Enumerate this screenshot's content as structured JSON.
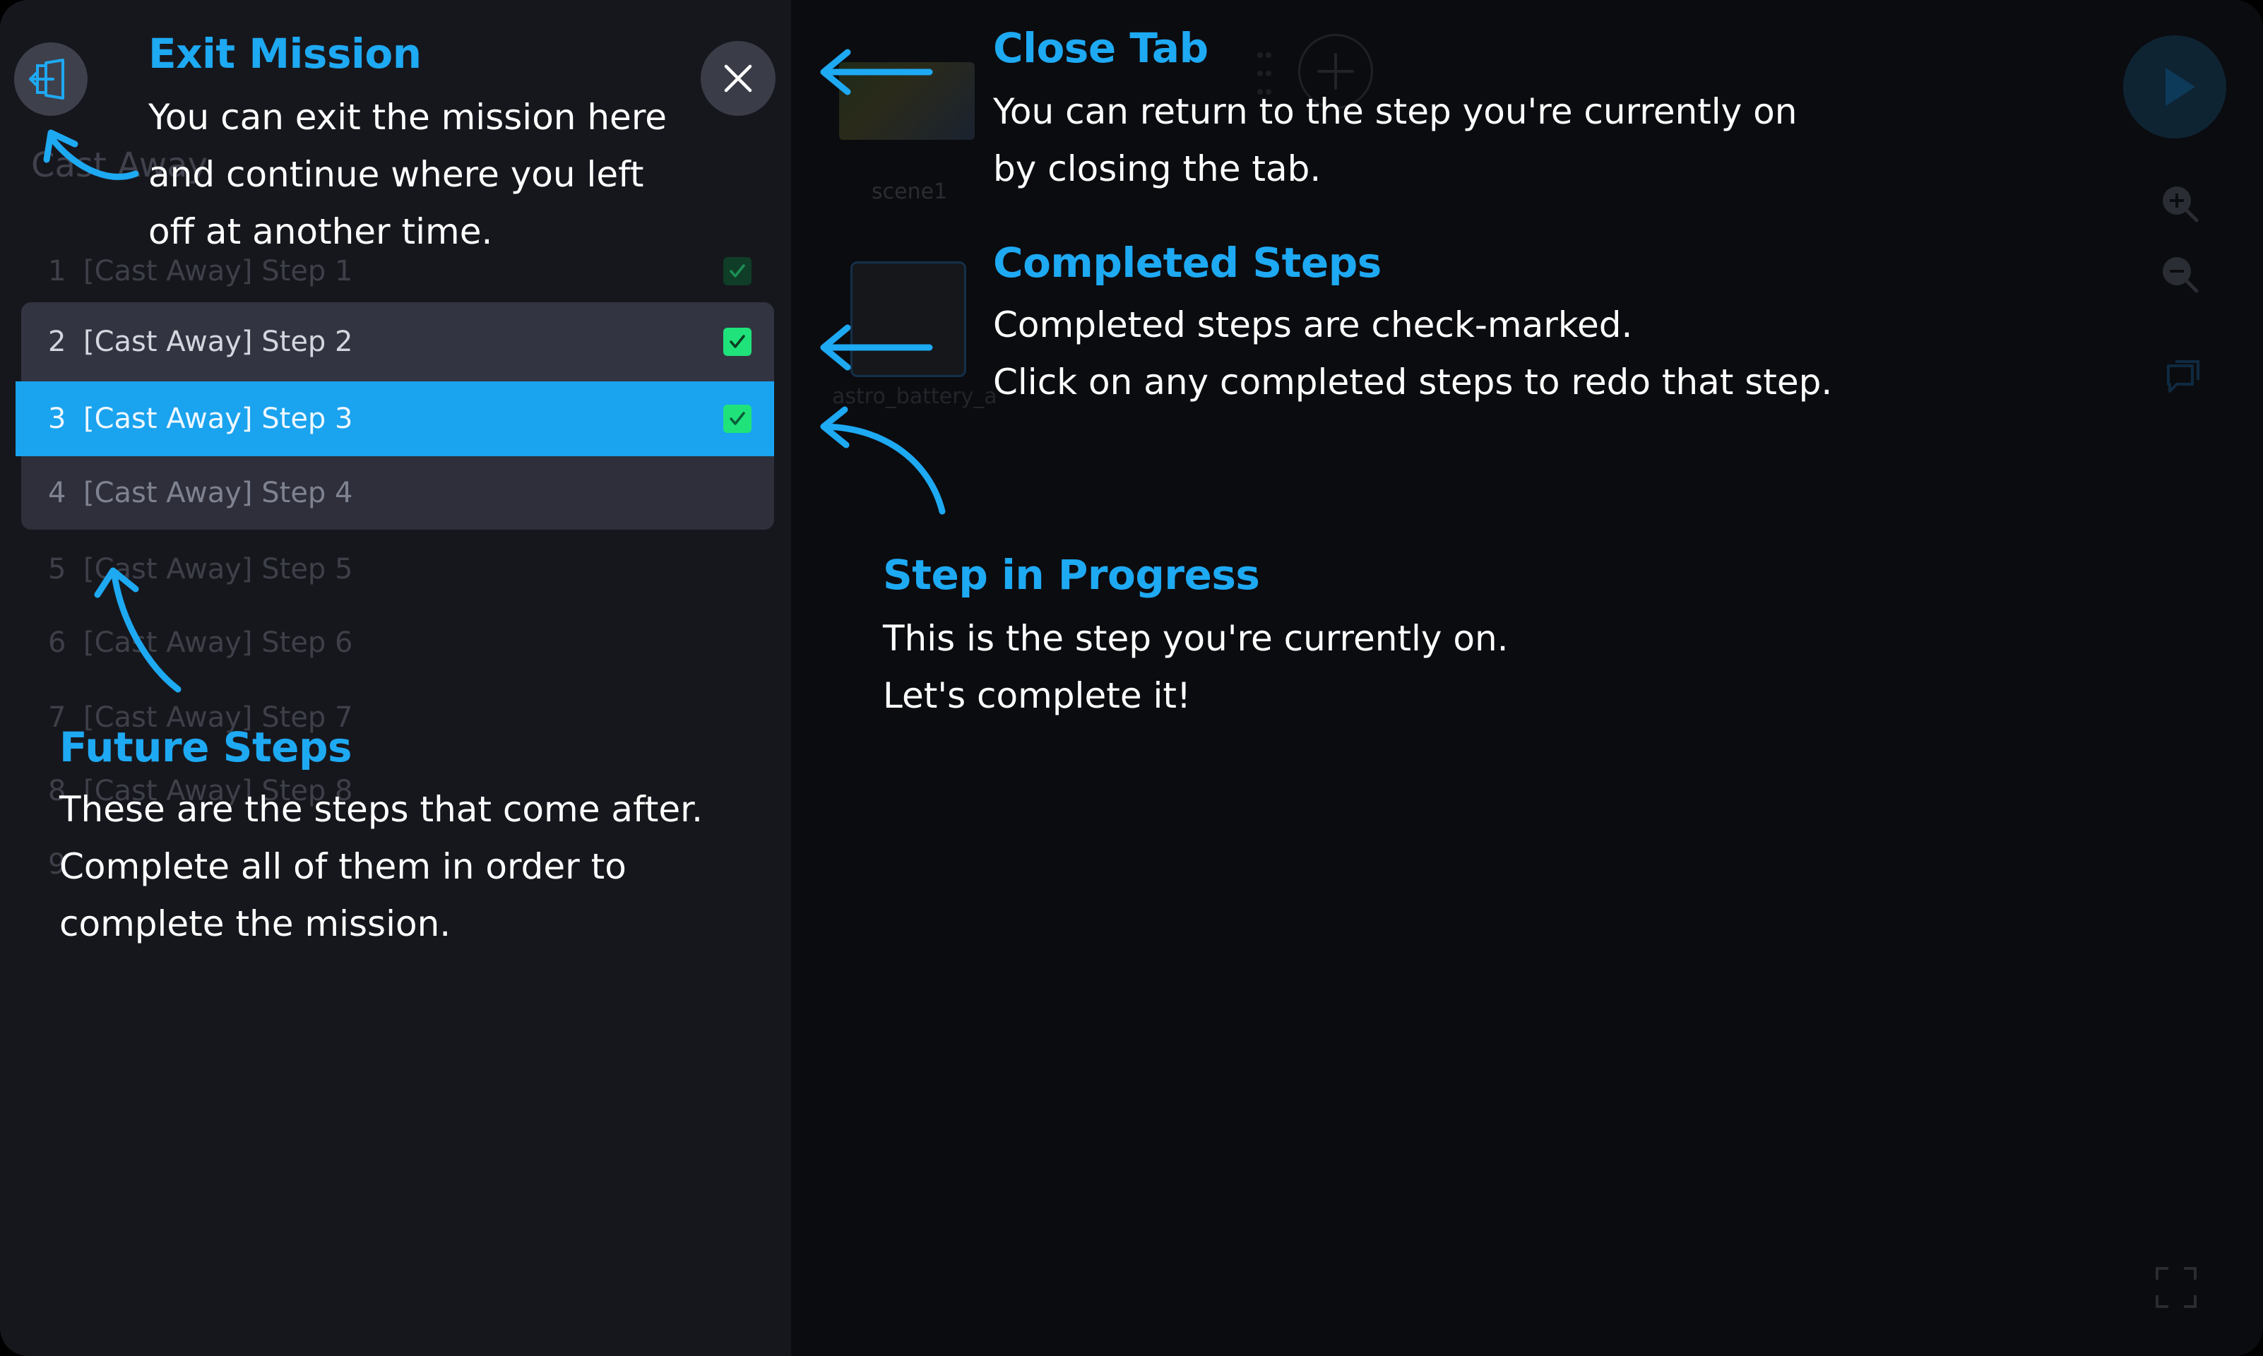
{
  "mission": {
    "title": "Cast Away",
    "steps": [
      {
        "number": "1",
        "label": "[Cast Away] Step 1",
        "completed": true
      },
      {
        "number": "2",
        "label": "[Cast Away] Step 2",
        "completed": true
      },
      {
        "number": "3",
        "label": "[Cast Away] Step 3",
        "completed": true
      },
      {
        "number": "4",
        "label": "[Cast Away] Step 4",
        "completed": false
      },
      {
        "number": "5",
        "label": "[Cast Away] Step 5",
        "completed": false
      },
      {
        "number": "6",
        "label": "[Cast Away] Step 6",
        "completed": false
      },
      {
        "number": "7",
        "label": "[Cast Away] Step 7",
        "completed": false
      },
      {
        "number": "8",
        "label": "[Cast Away] Step 8",
        "completed": false
      },
      {
        "number": "9",
        "label": "",
        "completed": false
      }
    ]
  },
  "workspace": {
    "tab_label": "scene1",
    "asset_label": "astro_battery_a"
  },
  "tutorial": {
    "exit_mission": {
      "heading": "Exit Mission",
      "lines": [
        "You can exit the mission here",
        "and continue where you left",
        "off at another time."
      ]
    },
    "close_tab": {
      "heading": "Close Tab",
      "lines": [
        "You can return to the step you're currently on",
        "by closing the tab."
      ]
    },
    "completed_steps": {
      "heading": "Completed Steps",
      "lines": [
        "Completed steps are check-marked.",
        "Click on any completed steps to redo that step."
      ]
    },
    "step_in_progress": {
      "heading": "Step in Progress",
      "lines": [
        "This is the step you're currently on.",
        "Let's complete it!"
      ]
    },
    "future_steps": {
      "heading": "Future Steps",
      "lines": [
        "These are the steps that come after.",
        "Complete all of them in order to",
        "complete the mission."
      ]
    }
  },
  "colors": {
    "accent": "#1ea9f3",
    "check_green": "#1fe37a",
    "current_step": "#1aa3ee"
  },
  "icons": [
    "exit-door-icon",
    "close-x-icon",
    "checkmark-icon",
    "play-icon",
    "zoom-in-icon",
    "zoom-out-icon",
    "chat-icon",
    "fullscreen-icon",
    "add-icon",
    "drag-handle-icon"
  ]
}
